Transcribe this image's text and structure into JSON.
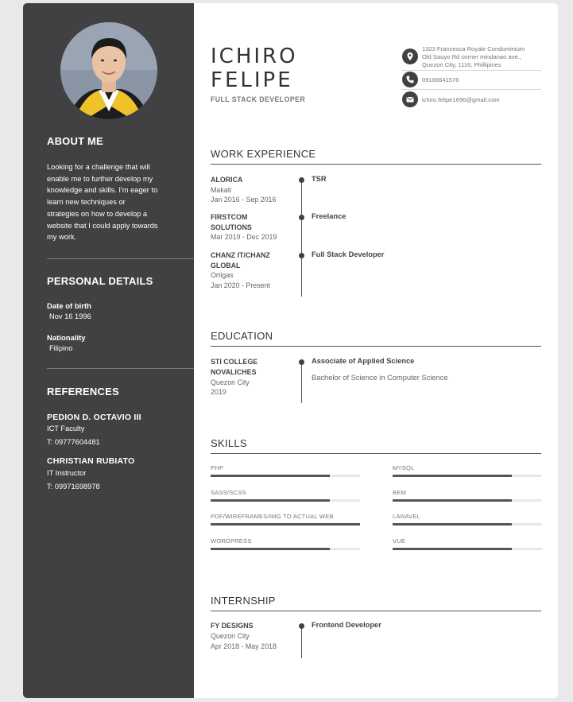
{
  "header": {
    "name_line1": "ICHIRO",
    "name_line2": "FELIPE",
    "role": "FULL STACK DEVELOPER"
  },
  "contact": {
    "address": [
      "1323 Francesca Royale Condominium",
      "Old Sauyo Rd corner mindanao ave.,",
      "Quezon City, 1116, Phillipines"
    ],
    "phone": "09166641576",
    "email": "ichiro.felipe1696@gmail.com",
    "icons": [
      "location-pin-icon",
      "phone-icon",
      "mail-icon"
    ]
  },
  "sidebar": {
    "about_title": "ABOUT ME",
    "about_lines": [
      "Looking for a challenge that will",
      "enable me to further develop my",
      "knowledge and skills. I'm eager to",
      "learn new techniques or",
      "strategies on how to develop a",
      "website that I could apply towards",
      "my work."
    ],
    "personal_title": "PERSONAL DETAILS",
    "dob_label": "Date of birth",
    "dob_value": "Nov 16 1996",
    "nationality_label": "Nationality",
    "nationality_value": "Filipino",
    "references_title": "REFERENCES",
    "references": [
      {
        "name": "PEDION D. OCTAVIO III",
        "position": "ICT Faculty",
        "phone": "T: 09777604481"
      },
      {
        "name": "CHRISTIAN RUBIATO",
        "position": "IT Instructor",
        "phone": "T: 09971698978"
      }
    ]
  },
  "work": {
    "title": "WORK EXPERIENCE",
    "entries": [
      {
        "org": "ALORICA",
        "location": "Makati",
        "dates": "Jan 2016 - Sep 2016",
        "role": "TSR"
      },
      {
        "org": "FIRSTCOM SOLUTIONS",
        "location": "",
        "dates": "Mar 2019 - Dec 2019",
        "role": "Freelance"
      },
      {
        "org": "CHANZ IT/CHANZ GLOBAL",
        "location": "Ortigas",
        "dates": "Jan 2020 - Present",
        "role": "Full Stack Developer"
      }
    ]
  },
  "education": {
    "title": "EDUCATION",
    "org": "STI COLLEGE NOVALICHES",
    "location": "Quezon City",
    "year": "2019",
    "degree1": "Associate of Applied Science",
    "degree2": "Bachelor of Science in Computer Science"
  },
  "skills": {
    "title": "SKILLS",
    "items": [
      {
        "name": "PHP",
        "level": 0.8
      },
      {
        "name": "MYSQL",
        "level": 0.8
      },
      {
        "name": "SASS/SCSS",
        "level": 0.8
      },
      {
        "name": "BEM",
        "level": 0.8
      },
      {
        "name": "PDF/WIREFRAMES/IMG TO ACTUAL WEB",
        "level": 1.0
      },
      {
        "name": "LARAVEL",
        "level": 0.8
      },
      {
        "name": "WORDPRESS",
        "level": 0.8
      },
      {
        "name": "VUE",
        "level": 0.8
      }
    ]
  },
  "internship": {
    "title": "INTERNSHIP",
    "org": "FY DESIGNS",
    "location": "Quezon City",
    "dates": "Apr 2018 - May 2018",
    "role": "Frontend Developer"
  },
  "colors": {
    "sidebar": "#414143",
    "accent": "#555555",
    "page_bg": "#e9e9ec"
  }
}
